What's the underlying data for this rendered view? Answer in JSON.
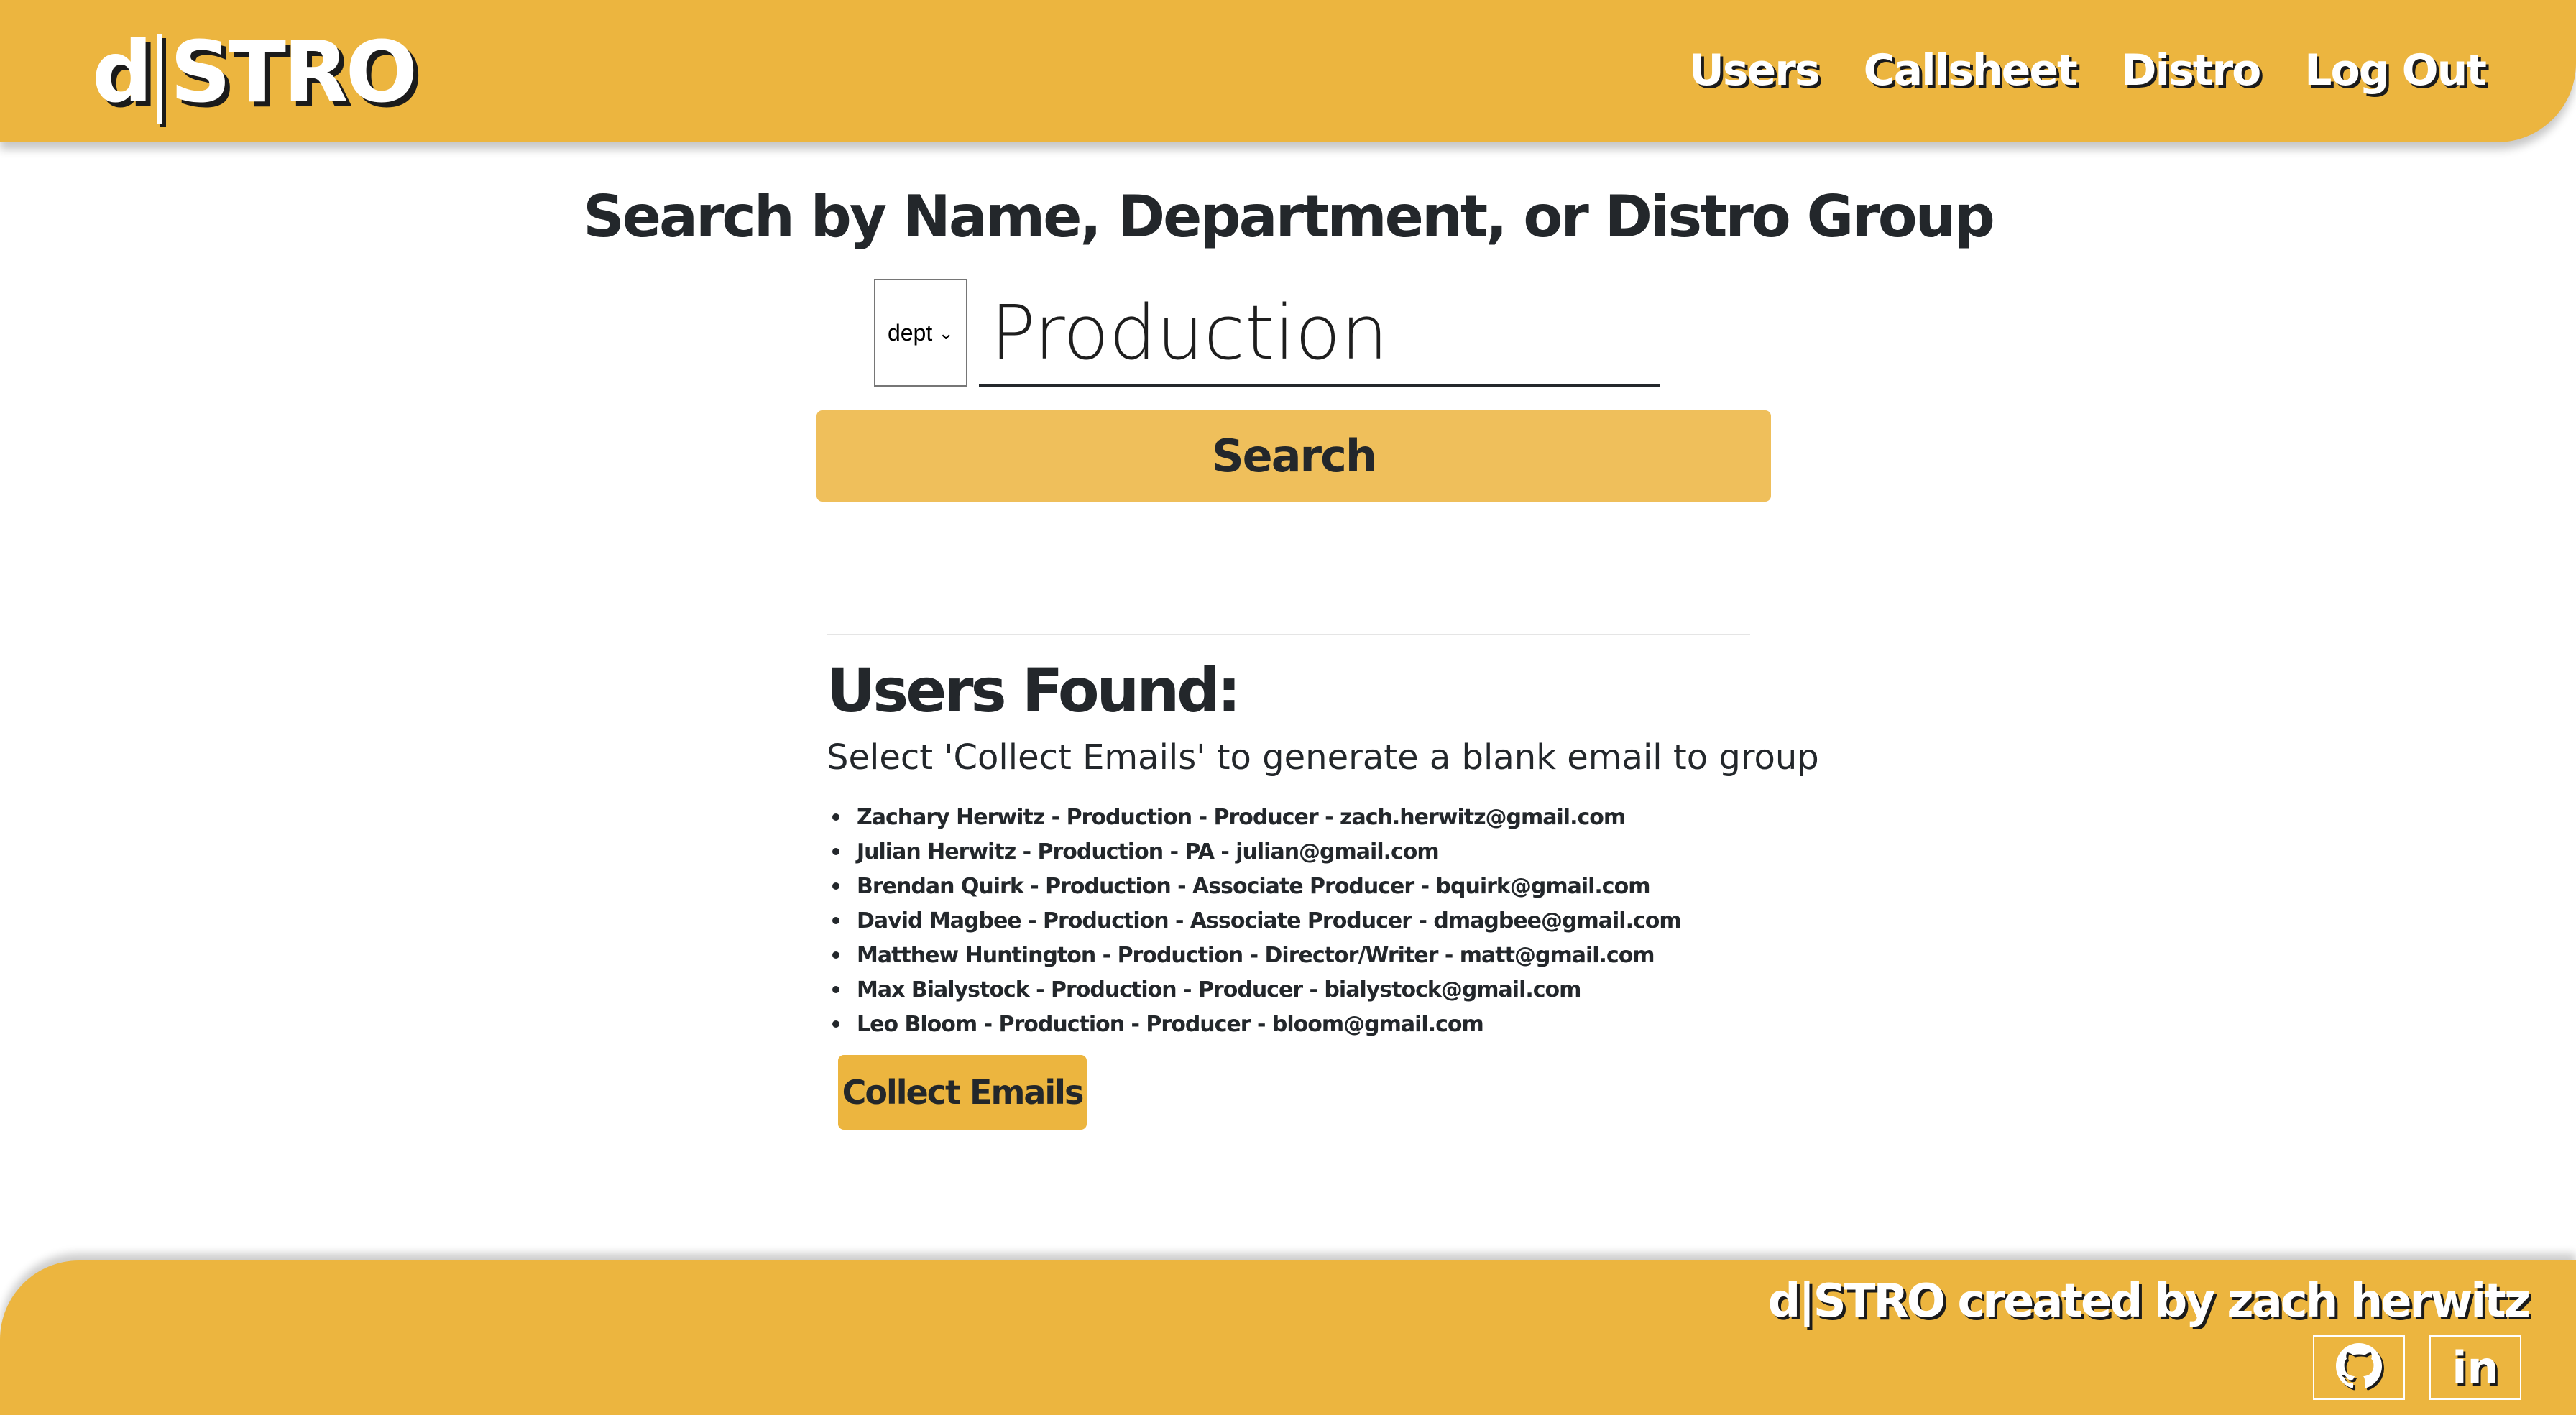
{
  "header": {
    "logo_left": "d",
    "logo_right": "STRO",
    "nav": [
      "Users",
      "Callsheet",
      "Distro",
      "Log Out"
    ]
  },
  "search": {
    "title": "Search by Name, Department, or Distro Group",
    "select_value": "dept",
    "query": "Production",
    "button_label": "Search"
  },
  "results": {
    "heading": "Users Found:",
    "subtitle": "Select 'Collect Emails' to generate a blank email to group",
    "users": [
      "Zachary Herwitz - Production - Producer - zach.herwitz@gmail.com",
      "Julian Herwitz - Production - PA - julian@gmail.com",
      "Brendan Quirk - Production - Associate Producer - bquirk@gmail.com",
      "David Magbee - Production - Associate Producer - dmagbee@gmail.com",
      "Matthew Huntington - Production - Director/Writer - matt@gmail.com",
      "Max Bialystock - Production - Producer - bialystock@gmail.com",
      "Leo Bloom - Production - Producer - bloom@gmail.com"
    ],
    "collect_label": "Collect Emails"
  },
  "footer": {
    "credit": "d|STRO created by zach herwitz",
    "linkedin_label": "in",
    "icons": [
      "github-icon",
      "linkedin-icon"
    ]
  },
  "colors": {
    "brand_yellow": "#ecb53f",
    "button_yellow": "#efbf5b",
    "text_dark": "#23272b"
  }
}
